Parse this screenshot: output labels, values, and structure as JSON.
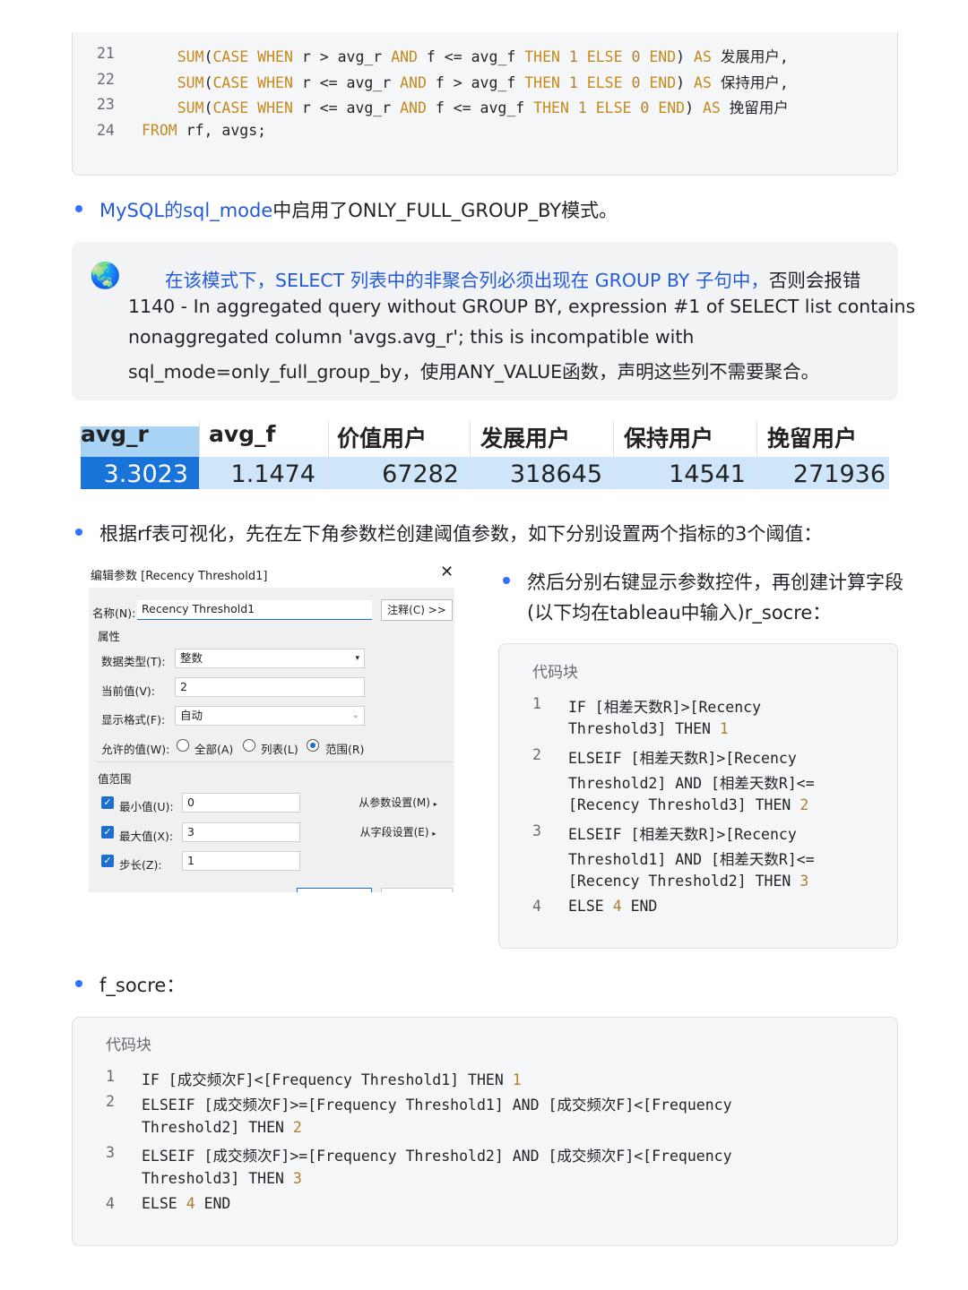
{
  "top_code": {
    "lines": [
      {
        "n": "21",
        "indent": "    ",
        "parts": [
          [
            "kw",
            "SUM"
          ],
          [
            "t",
            "("
          ],
          [
            "kw",
            "CASE WHEN"
          ],
          [
            "t",
            " r > avg_r "
          ],
          [
            "kw",
            "AND"
          ],
          [
            "t",
            " f <= avg_f "
          ],
          [
            "kw",
            "THEN"
          ],
          [
            "t",
            " "
          ],
          [
            "num",
            "1"
          ],
          [
            "t",
            " "
          ],
          [
            "kw",
            "ELSE"
          ],
          [
            "t",
            " "
          ],
          [
            "num",
            "0"
          ],
          [
            "t",
            " "
          ],
          [
            "kw",
            "END"
          ],
          [
            "t",
            ") "
          ],
          [
            "kw",
            "AS"
          ],
          [
            "t",
            " 发展用户,"
          ]
        ]
      },
      {
        "n": "22",
        "indent": "    ",
        "parts": [
          [
            "kw",
            "SUM"
          ],
          [
            "t",
            "("
          ],
          [
            "kw",
            "CASE WHEN"
          ],
          [
            "t",
            " r <= avg_r "
          ],
          [
            "kw",
            "AND"
          ],
          [
            "t",
            " f > avg_f "
          ],
          [
            "kw",
            "THEN"
          ],
          [
            "t",
            " "
          ],
          [
            "num",
            "1"
          ],
          [
            "t",
            " "
          ],
          [
            "kw",
            "ELSE"
          ],
          [
            "t",
            " "
          ],
          [
            "num",
            "0"
          ],
          [
            "t",
            " "
          ],
          [
            "kw",
            "END"
          ],
          [
            "t",
            ") "
          ],
          [
            "kw",
            "AS"
          ],
          [
            "t",
            " 保持用户,"
          ]
        ]
      },
      {
        "n": "23",
        "indent": "    ",
        "parts": [
          [
            "kw",
            "SUM"
          ],
          [
            "t",
            "("
          ],
          [
            "kw",
            "CASE WHEN"
          ],
          [
            "t",
            " r <= avg_r "
          ],
          [
            "kw",
            "AND"
          ],
          [
            "t",
            " f <= avg_f "
          ],
          [
            "kw",
            "THEN"
          ],
          [
            "t",
            " "
          ],
          [
            "num",
            "1"
          ],
          [
            "t",
            " "
          ],
          [
            "kw",
            "ELSE"
          ],
          [
            "t",
            " "
          ],
          [
            "num",
            "0"
          ],
          [
            "t",
            " "
          ],
          [
            "kw",
            "END"
          ],
          [
            "t",
            ") "
          ],
          [
            "kw",
            "AS"
          ],
          [
            "t",
            " 挽留用户"
          ]
        ]
      },
      {
        "n": "24",
        "indent": "",
        "parts": [
          [
            "kw",
            "FROM"
          ],
          [
            "t",
            " rf, avgs;"
          ]
        ]
      }
    ]
  },
  "bullet1": {
    "link": "MySQL的sql_mode",
    "rest": "中启用了ONLY_FULL_GROUP_BY模式。"
  },
  "callout": {
    "icon": "🌏",
    "highlight": "在该模式下，SELECT 列表中的非聚合列必须出现在 GROUP BY 子句中，",
    "tail": "否则会报错",
    "line2": "1140 - In aggregated query without GROUP BY, expression #1 of SELECT list contains",
    "line3": "nonaggregated column 'avgs.avg_r'; this is incompatible with",
    "line4": "sql_mode=only_full_group_by，使用ANY_VALUE函数，声明这些列不需要聚合。"
  },
  "result_table": {
    "headers": [
      "avg_r",
      "avg_f",
      "价值用户",
      "发展用户",
      "保持用户",
      "挽留用户"
    ],
    "values": [
      "3.3023",
      "1.1474",
      "67282",
      "318645",
      "14541",
      "271936"
    ]
  },
  "bullet2": "根据rf表可视化，先在左下角参数栏创建阈值参数，如下分别设置两个指标的3个阈值：",
  "dialog": {
    "title": "编辑参数 [Recency Threshold1]",
    "name_label": "名称(N):",
    "name_value": "Recency Threshold1",
    "comment_btn": "注释(C) >>",
    "props": "属性",
    "dtype_label": "数据类型(T):",
    "dtype_value": "整数",
    "current_label": "当前值(V):",
    "current_value": "2",
    "format_label": "显示格式(F):",
    "format_value": "自动",
    "allow_label": "允许的值(W):",
    "opt_all": "全部(A)",
    "opt_list": "列表(L)",
    "opt_range": "范围(R)",
    "range_section": "值范围",
    "min_label": "最小值(U):",
    "min_value": "0",
    "max_label": "最大值(X):",
    "max_value": "3",
    "step_label": "步长(Z):",
    "step_value": "1",
    "from_param_btn": "从参数设置(M)",
    "from_field_btn": "从字段设置(E)"
  },
  "bullet3": {
    "line1": "然后分别右键显示参数控件，再创建计算字段",
    "line2": "(以下均在tableau中输入)r_socre："
  },
  "r_code": {
    "title": "代码块",
    "lines": [
      {
        "n": "1",
        "rows": [
          [
            [
              "kw2",
              "IF"
            ],
            [
              "t",
              " [相差天数R]>[Recency"
            ]
          ],
          [
            [
              "t",
              "Threshold3] "
            ],
            [
              "kw2",
              "THEN"
            ],
            [
              "t",
              " "
            ],
            [
              "num",
              "1"
            ]
          ]
        ]
      },
      {
        "n": "2",
        "rows": [
          [
            [
              "kw2",
              "ELSEIF"
            ],
            [
              "t",
              " [相差天数R]>[Recency"
            ]
          ],
          [
            [
              "t",
              "Threshold2] "
            ],
            [
              "kw2",
              "AND"
            ],
            [
              "t",
              " [相差天数R]<="
            ]
          ],
          [
            [
              "t",
              "[Recency Threshold3] "
            ],
            [
              "kw2",
              "THEN"
            ],
            [
              "t",
              " "
            ],
            [
              "num",
              "2"
            ]
          ]
        ]
      },
      {
        "n": "3",
        "rows": [
          [
            [
              "kw2",
              "ELSEIF"
            ],
            [
              "t",
              " [相差天数R]>[Recency"
            ]
          ],
          [
            [
              "t",
              "Threshold1] "
            ],
            [
              "kw2",
              "AND"
            ],
            [
              "t",
              " [相差天数R]<="
            ]
          ],
          [
            [
              "t",
              "[Recency Threshold2] "
            ],
            [
              "kw2",
              "THEN"
            ],
            [
              "t",
              " "
            ],
            [
              "num",
              "3"
            ]
          ]
        ]
      },
      {
        "n": "4",
        "rows": [
          [
            [
              "kw2",
              "ELSE"
            ],
            [
              "t",
              " "
            ],
            [
              "num",
              "4"
            ],
            [
              "t",
              " "
            ],
            [
              "kw2",
              "END"
            ]
          ]
        ]
      }
    ]
  },
  "bullet4": "f_socre：",
  "f_code": {
    "title": "代码块",
    "lines": [
      {
        "n": "1",
        "rows": [
          [
            [
              "kw2",
              "IF"
            ],
            [
              "t",
              " [成交频次F]<[Frequency Threshold1] "
            ],
            [
              "kw2",
              "THEN"
            ],
            [
              "t",
              " "
            ],
            [
              "num",
              "1"
            ]
          ]
        ]
      },
      {
        "n": "2",
        "rows": [
          [
            [
              "kw2",
              "ELSEIF"
            ],
            [
              "t",
              " [成交频次F]>=[Frequency Threshold1] "
            ],
            [
              "kw2",
              "AND"
            ],
            [
              "t",
              " [成交频次F]<[Frequency"
            ]
          ],
          [
            [
              "t",
              "Threshold2] "
            ],
            [
              "kw2",
              "THEN"
            ],
            [
              "t",
              " "
            ],
            [
              "num",
              "2"
            ]
          ]
        ]
      },
      {
        "n": "3",
        "rows": [
          [
            [
              "kw2",
              "ELSEIF"
            ],
            [
              "t",
              " [成交频次F]>=[Frequency Threshold2] "
            ],
            [
              "kw2",
              "AND"
            ],
            [
              "t",
              " [成交频次F]<[Frequency"
            ]
          ],
          [
            [
              "t",
              "Threshold3] "
            ],
            [
              "kw2",
              "THEN"
            ],
            [
              "t",
              " "
            ],
            [
              "num",
              "3"
            ]
          ]
        ]
      },
      {
        "n": "4",
        "rows": [
          [
            [
              "kw2",
              "ELSE"
            ],
            [
              "t",
              " "
            ],
            [
              "num",
              "4"
            ],
            [
              "t",
              " "
            ],
            [
              "kw2",
              "END"
            ]
          ]
        ]
      }
    ]
  },
  "colors": {
    "accent": "#3370ff",
    "keyword": "#c5891d",
    "link": "#245bdb",
    "table_highlight": "#a9d3f5",
    "table_selected": "#1a73d9"
  }
}
